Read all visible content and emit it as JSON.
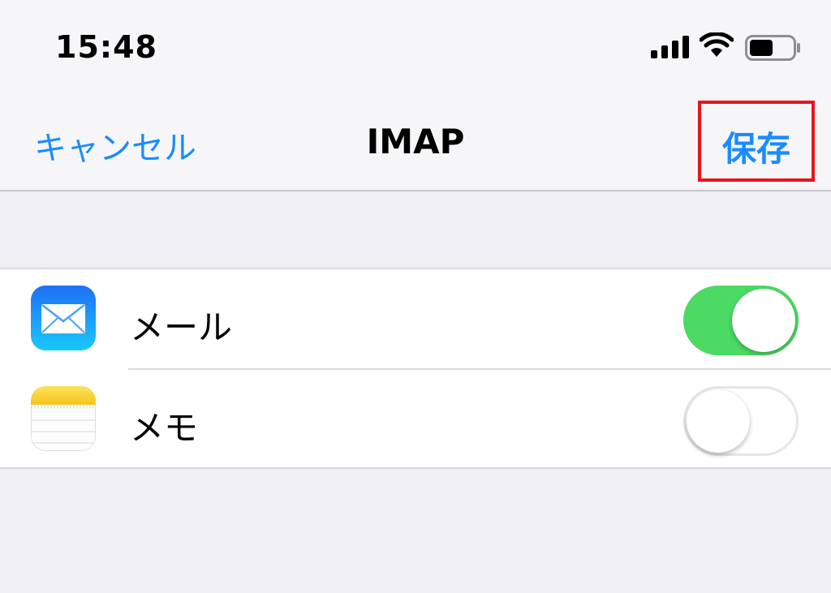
{
  "status_bar": {
    "time": "15:48",
    "icons": [
      "signal-icon",
      "wifi-icon",
      "battery-icon"
    ]
  },
  "nav": {
    "cancel_label": "キャンセル",
    "title": "IMAP",
    "save_label": "保存"
  },
  "rows": [
    {
      "label": "メール",
      "icon": "mail-app-icon",
      "enabled": true
    },
    {
      "label": "メモ",
      "icon": "notes-app-icon",
      "enabled": false
    }
  ],
  "colors": {
    "accent": "#1a8cff",
    "toggle_on": "#4cd964",
    "highlight": "#e8141c",
    "background": "#efeff4"
  }
}
